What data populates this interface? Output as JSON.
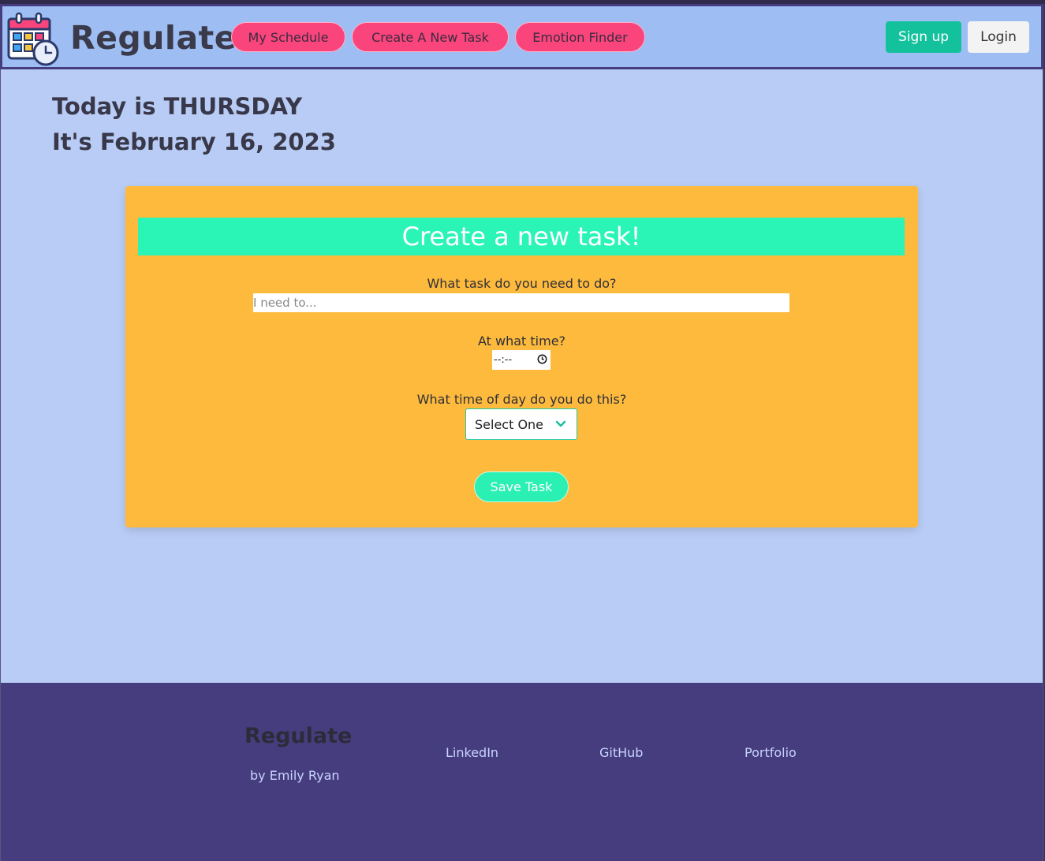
{
  "header": {
    "brand": "Regulate",
    "nav": [
      "My Schedule",
      "Create A New Task",
      "Emotion Finder"
    ],
    "signup_label": "Sign up",
    "login_label": "Login"
  },
  "main": {
    "today_text": "Today is THURSDAY",
    "date_text": "It's February 16, 2023"
  },
  "form": {
    "title": "Create a new task!",
    "task_label": "What task do you need to do?",
    "task_placeholder": "I need to...",
    "time_label": "At what time?",
    "time_value": "--:--",
    "period_label": "What time of day do you do this?",
    "period_selected": "Select One",
    "save_label": "Save Task"
  },
  "footer": {
    "brand": "Regulate",
    "byline": "by Emily Ryan",
    "links": [
      "LinkedIn",
      "GitHub",
      "Portfolio"
    ]
  },
  "colors": {
    "nav_pill": "#f9457c",
    "accent_green": "#13c29d",
    "card": "#fdba3c",
    "card_title": "#2bf5b6",
    "page_bg": "#b8ccf5",
    "footer_bg": "#463d7e"
  }
}
